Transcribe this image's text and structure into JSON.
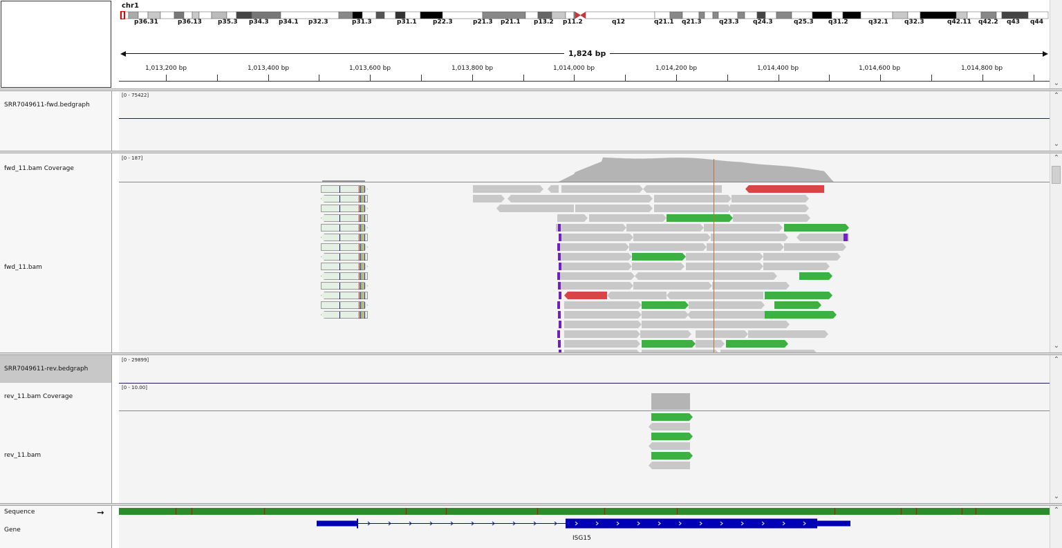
{
  "header": {
    "chromosome": "chr1",
    "span_label": "1,824 bp",
    "cytobands": [
      "p36.31",
      "p36.13",
      "p35.3",
      "p34.3",
      "p34.1",
      "p32.3",
      "p31.3",
      "p31.1",
      "p22.3",
      "p21.3",
      "p21.1",
      "p13.2",
      "p11.2",
      "q12",
      "q21.1",
      "q21.3",
      "q23.3",
      "q24.3",
      "q25.3",
      "q31.2",
      "q32.1",
      "q32.3",
      "q42.11",
      "q42.2",
      "q43",
      "q44"
    ],
    "ruler_ticks": [
      "1,013,200 bp",
      "1,013,400 bp",
      "1,013,600 bp",
      "1,013,800 bp",
      "1,014,000 bp",
      "1,014,200 bp",
      "1,014,400 bp",
      "1,014,600 bp",
      "1,014,800 bp"
    ]
  },
  "tracks": {
    "fwd_bedgraph": {
      "name": "SRR7049611-fwd.bedgraph",
      "range": "[0 - 75422]"
    },
    "fwd_coverage": {
      "name": "fwd_11.bam Coverage",
      "range": "[0 - 187]"
    },
    "fwd_bam": {
      "name": "fwd_11.bam"
    },
    "rev_bedgraph": {
      "name": "SRR7049611-rev.bedgraph",
      "range": "[0 - 29899]"
    },
    "rev_coverage": {
      "name": "rev_11.bam Coverage",
      "range": "[0 - 10.00]"
    },
    "rev_bam": {
      "name": "rev_11.bam"
    },
    "sequence": {
      "name": "Sequence"
    },
    "gene": {
      "name": "Gene",
      "gene_label": "ISG15"
    }
  },
  "colors": {
    "read_gray": "#c8c8c8",
    "read_green": "#3cb043",
    "read_red": "#d94545",
    "gene_blue": "#0000b4",
    "coverage_gray": "#b4b4b4",
    "bedgraph_line": "#1a1a6e"
  }
}
